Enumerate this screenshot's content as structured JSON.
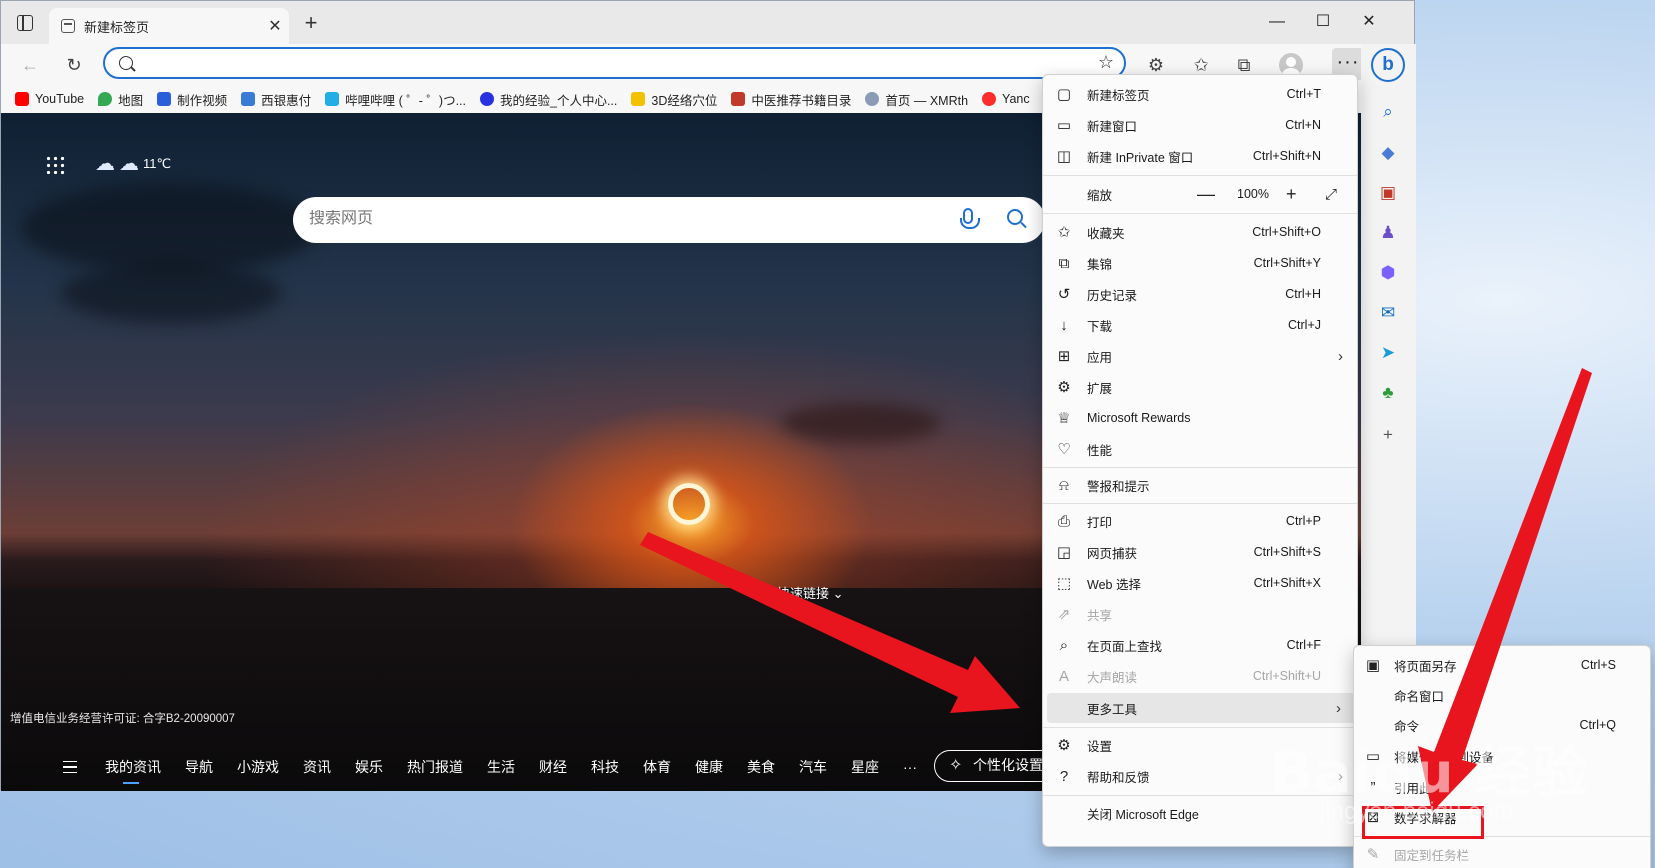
{
  "window": {
    "tab_title": "新建标签页",
    "tab_close": "✕",
    "new_tab": "+",
    "minimize": "—",
    "maximize": "☐",
    "close": "✕"
  },
  "toolbar": {
    "back": "←",
    "refresh": "↻",
    "address_value": "",
    "address_placeholder": "",
    "more": "···"
  },
  "favorites": [
    {
      "label": "YouTube",
      "color": "#ff0000"
    },
    {
      "label": "地图",
      "color": "#34a853"
    },
    {
      "label": "制作视频",
      "color": "#2b5fd9"
    },
    {
      "label": "西银惠付",
      "color": "#3a7bd5"
    },
    {
      "label": "哔哩哔哩 ( ゜- ゜)つ...",
      "color": "#23ade5"
    },
    {
      "label": "我的经验_个人中心...",
      "color": "#2932e1"
    },
    {
      "label": "3D经络穴位",
      "color": "#f2c200"
    },
    {
      "label": "中医推荐书籍目录",
      "color": "#c0392b"
    },
    {
      "label": "首页 — XMRth",
      "color": "#8a9bb5"
    },
    {
      "label": "Yanc",
      "color": "#ff2d2d"
    }
  ],
  "newtab": {
    "weather_temp": "11℃",
    "search_placeholder": "搜索网页",
    "quick_links": "快速链接 ⌄",
    "license": "增值电信业务经营许可证: 合字B2-20090007",
    "nav": [
      "我的资讯",
      "导航",
      "小游戏",
      "资讯",
      "娱乐",
      "热门报道",
      "生活",
      "财经",
      "科技",
      "体育",
      "健康",
      "美食",
      "汽车",
      "星座",
      "···"
    ],
    "personalize": "个性化设置"
  },
  "menu": {
    "new_tab": {
      "label": "新建标签页",
      "shortcut": "Ctrl+T"
    },
    "new_window": {
      "label": "新建窗口",
      "shortcut": "Ctrl+N"
    },
    "new_inprivate": {
      "label": "新建 InPrivate 窗口",
      "shortcut": "Ctrl+Shift+N"
    },
    "zoom": {
      "label": "缩放",
      "minus": "—",
      "value": "100%",
      "plus": "+"
    },
    "favorites": {
      "label": "收藏夹",
      "shortcut": "Ctrl+Shift+O"
    },
    "collections": {
      "label": "集锦",
      "shortcut": "Ctrl+Shift+Y"
    },
    "history": {
      "label": "历史记录",
      "shortcut": "Ctrl+H"
    },
    "downloads": {
      "label": "下载",
      "shortcut": "Ctrl+J"
    },
    "apps": {
      "label": "应用"
    },
    "extensions": {
      "label": "扩展"
    },
    "rewards": {
      "label": "Microsoft Rewards"
    },
    "performance": {
      "label": "性能"
    },
    "alerts": {
      "label": "警报和提示"
    },
    "print": {
      "label": "打印",
      "shortcut": "Ctrl+P"
    },
    "capture": {
      "label": "网页捕获",
      "shortcut": "Ctrl+Shift+S"
    },
    "web_select": {
      "label": "Web 选择",
      "shortcut": "Ctrl+Shift+X"
    },
    "share": {
      "label": "共享"
    },
    "find": {
      "label": "在页面上查找",
      "shortcut": "Ctrl+F"
    },
    "read_aloud": {
      "label": "大声朗读",
      "shortcut": "Ctrl+Shift+U"
    },
    "more_tools": {
      "label": "更多工具"
    },
    "settings": {
      "label": "设置"
    },
    "help": {
      "label": "帮助和反馈"
    },
    "close_edge": {
      "label": "关闭 Microsoft Edge"
    }
  },
  "submenu": {
    "save_as": {
      "label": "将页面另存",
      "shortcut": "Ctrl+S"
    },
    "name_window": {
      "label": "命名窗口"
    },
    "command": {
      "label": "命令",
      "shortcut": "Ctrl+Q"
    },
    "cast": {
      "label": "将媒体投放到设备"
    },
    "cite": {
      "label": "引用此项"
    },
    "math_solver": {
      "label": "数学求解器"
    },
    "pin_taskbar": {
      "label": "固定到任务栏"
    }
  },
  "watermark": {
    "main": "Baidu 经验",
    "sub": "jingyan.baidu.com"
  },
  "colors": {
    "accent": "#1f6fd1",
    "highlight_box": "#e8141e",
    "arrow": "#e8141e"
  }
}
